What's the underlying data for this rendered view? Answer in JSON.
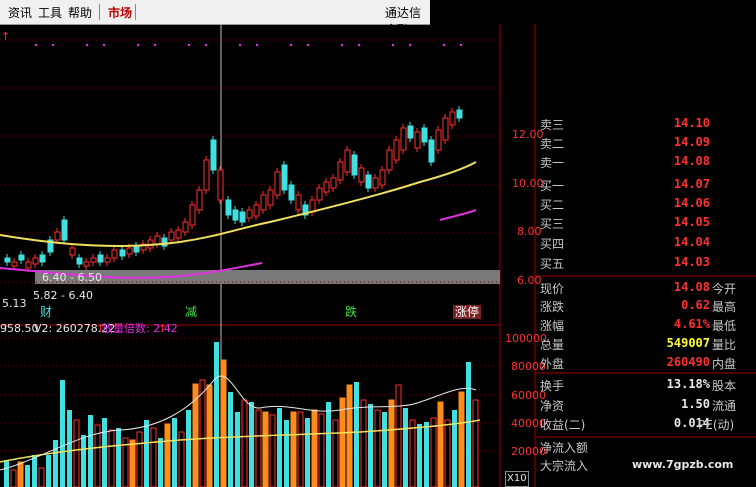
{
  "menu": {
    "items": [
      "资讯",
      "工具",
      "帮助"
    ],
    "active": "市场",
    "broker": "通达信金融"
  },
  "price_chart": {
    "y_ticks": [
      "12.00",
      "10.00",
      "8.00",
      "6.00"
    ],
    "range_label": "6.40 - 6.50",
    "range_label2": "5.82 - 6.40",
    "low_label": "5.13",
    "marker_labels": [
      "财",
      "减",
      "跌",
      "涨停"
    ]
  },
  "volume_chart": {
    "header_left": "958.50",
    "v2_label": "V2: 260278.22",
    "factor_label": "放量倍数: 2.42",
    "y_ticks": [
      "100000",
      "80000",
      "60000",
      "40000",
      "20000"
    ],
    "unit": "X10"
  },
  "order_book": {
    "sell": [
      {
        "label": "卖三",
        "price": "14.10"
      },
      {
        "label": "卖二",
        "price": "14.09"
      },
      {
        "label": "卖一",
        "price": "14.08"
      }
    ],
    "buy": [
      {
        "label": "买一",
        "price": "14.07"
      },
      {
        "label": "买二",
        "price": "14.06"
      },
      {
        "label": "买三",
        "price": "14.05"
      },
      {
        "label": "买四",
        "price": "14.04"
      },
      {
        "label": "买五",
        "price": "14.03"
      }
    ]
  },
  "quote": [
    {
      "label": "现价",
      "value": "14.08",
      "tail": "今开",
      "color": "#ff3030"
    },
    {
      "label": "涨跌",
      "value": "0.62",
      "tail": "最高",
      "color": "#ff3030"
    },
    {
      "label": "涨幅",
      "value": "4.61%",
      "tail": "最低",
      "color": "#ff3030"
    },
    {
      "label": "总量",
      "value": "549007",
      "tail": "量比",
      "color": "#ffff30"
    },
    {
      "label": "外盘",
      "value": "260490",
      "tail": "内盘",
      "color": "#ff3030"
    }
  ],
  "fundamentals": [
    {
      "label": "换手",
      "value": "13.18%",
      "tail": "股本"
    },
    {
      "label": "净资",
      "value": "1.50",
      "tail": "流通"
    },
    {
      "label": "收益(二)",
      "value": "0.014",
      "tail": "PE(动)"
    }
  ],
  "flows": [
    "净流入额",
    "大宗流入"
  ],
  "watermark": "www.7gpzb.com",
  "colors": {
    "up": "#ff3030",
    "down": "#40e0e0",
    "ma_yellow": "#f0e060",
    "ma_magenta": "#e030e0",
    "vol_orange": "#ff8c1a"
  }
}
